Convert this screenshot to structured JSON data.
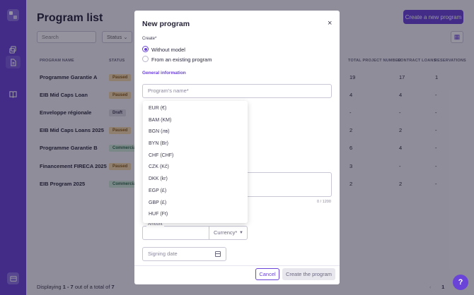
{
  "page": {
    "title": "Program list",
    "create_button": "Create a new program",
    "search_placeholder": "Search",
    "status_filter": "Status",
    "columns": [
      "PROGRAM NAME",
      "STATUS",
      "TOTAL PROJECT NUMBER",
      "CONTRACT LOANS",
      "RESERVATIONS"
    ],
    "rows": [
      {
        "name": "Programme Garantie A",
        "status": "Paused",
        "status_kind": "paused",
        "total": "19",
        "contracts": "17",
        "reservations": "1"
      },
      {
        "name": "EIB Mid Caps Loan",
        "status": "Paused",
        "status_kind": "paused",
        "total": "4",
        "contracts": "4",
        "reservations": "-"
      },
      {
        "name": "Enveloppe régionale",
        "status": "Draft",
        "status_kind": "draft",
        "total": "-",
        "contracts": "-",
        "reservations": "-"
      },
      {
        "name": "EIB Mid Caps Loans 2025",
        "status": "Paused",
        "status_kind": "paused",
        "total": "2",
        "contracts": "2",
        "reservations": "-"
      },
      {
        "name": "Programme Garantie B",
        "status": "Commercial",
        "status_kind": "commercial",
        "total": "6",
        "contracts": "4",
        "reservations": "-"
      },
      {
        "name": "Financement FIRECA 2025",
        "status": "Paused",
        "status_kind": "paused",
        "total": "3",
        "contracts": "-",
        "reservations": "-"
      },
      {
        "name": "EIB Program 2025",
        "status": "Commercial",
        "status_kind": "commercial",
        "total": "2",
        "contracts": "2",
        "reservations": "-"
      }
    ],
    "footer_prefix": "Displaying",
    "footer_range": "1 - 7",
    "footer_mid": "out of a total of",
    "footer_total": "7",
    "page_number": "1",
    "help": "?"
  },
  "modal": {
    "title": "New program",
    "create_label": "Create*",
    "option_without_model": "Without model",
    "option_existing": "From an existing program",
    "section_general": "General information",
    "name_placeholder": "Program's name*",
    "char_counter": "0 / 1200",
    "amount_label": "Amount",
    "currency_placeholder": "Currency*",
    "signing_date_placeholder": "Signing date",
    "cancel": "Cancel",
    "create": "Create the program"
  },
  "currency_dropdown": [
    "EUR (€)",
    "BAM (KM)",
    "BGN (лв)",
    "BYN (Br)",
    "CHF (CHF)",
    "CZK (Kč)",
    "DKK (kr)",
    "EGP (£)",
    "GBP (£)",
    "HUF (Ft)"
  ],
  "colors": {
    "accent": "#6a43d8",
    "paused": "#f5d9a8",
    "draft": "#dcdbe4",
    "commercial": "#cfe9d8"
  }
}
